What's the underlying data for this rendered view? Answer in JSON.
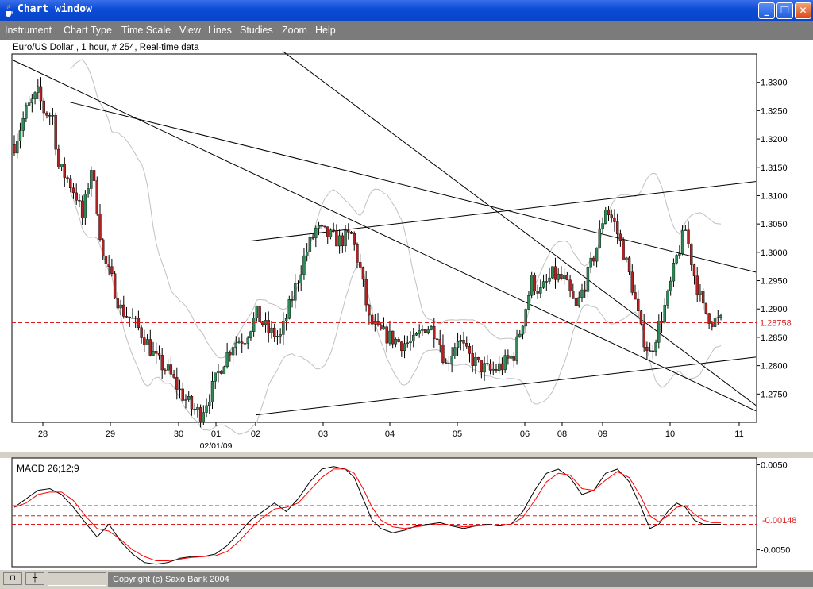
{
  "window": {
    "title": "Chart window"
  },
  "menu": [
    "Instrument",
    "Chart Type",
    "Time Scale",
    "View",
    "Lines",
    "Studies",
    "Zoom",
    "Help"
  ],
  "chart_data": [
    {
      "type": "candlestick",
      "title": "Euro/US Dollar , 1 hour, # 254, Real-time data",
      "ylim": [
        1.27,
        1.335
      ],
      "y_ticks": [
        "1.3300",
        "1.3250",
        "1.3200",
        "1.3150",
        "1.3100",
        "1.3050",
        "1.3000",
        "1.2950",
        "1.2900",
        "1.2850",
        "1.2800",
        "1.2750"
      ],
      "x_ticks": [
        "28",
        "29",
        "30",
        "01",
        "02",
        "03",
        "04",
        "05",
        "06",
        "08",
        "09",
        "10",
        "11"
      ],
      "x_subtick": "02/01/09",
      "current_price": "1.28758",
      "current_price_value": 1.28758,
      "price_path": [
        [
          0,
          1.319
        ],
        [
          4,
          1.325
        ],
        [
          8,
          1.328
        ],
        [
          10,
          1.325
        ],
        [
          13,
          1.324
        ],
        [
          15,
          1.315
        ],
        [
          18,
          1.313
        ],
        [
          21,
          1.31
        ],
        [
          23,
          1.306
        ],
        [
          26,
          1.315
        ],
        [
          28,
          1.308
        ],
        [
          30,
          1.299
        ],
        [
          33,
          1.295
        ],
        [
          36,
          1.29
        ],
        [
          40,
          1.288
        ],
        [
          44,
          1.285
        ],
        [
          48,
          1.281
        ],
        [
          52,
          1.279
        ],
        [
          56,
          1.2755
        ],
        [
          60,
          1.2725
        ],
        [
          63,
          1.2715
        ],
        [
          67,
          1.276
        ],
        [
          70,
          1.28
        ],
        [
          74,
          1.284
        ],
        [
          78,
          1.285
        ],
        [
          82,
          1.289
        ],
        [
          86,
          1.286
        ],
        [
          90,
          1.285
        ],
        [
          94,
          1.292
        ],
        [
          98,
          1.299
        ],
        [
          102,
          1.304
        ],
        [
          106,
          1.303
        ],
        [
          110,
          1.302
        ],
        [
          114,
          1.303
        ],
        [
          117,
          1.297
        ],
        [
          120,
          1.288
        ],
        [
          123,
          1.286
        ],
        [
          127,
          1.285
        ],
        [
          131,
          1.284
        ],
        [
          135,
          1.284
        ],
        [
          139,
          1.287
        ],
        [
          143,
          1.286
        ],
        [
          146,
          1.28
        ],
        [
          150,
          1.285
        ],
        [
          153,
          1.282
        ],
        [
          157,
          1.28
        ],
        [
          161,
          1.279
        ],
        [
          165,
          1.28
        ],
        [
          169,
          1.282
        ],
        [
          172,
          1.288
        ],
        [
          175,
          1.295
        ],
        [
          178,
          1.293
        ],
        [
          182,
          1.296
        ],
        [
          186,
          1.295
        ],
        [
          190,
          1.29
        ],
        [
          194,
          1.296
        ],
        [
          197,
          1.301
        ],
        [
          200,
          1.308
        ],
        [
          203,
          1.305
        ],
        [
          206,
          1.3
        ],
        [
          209,
          1.294
        ],
        [
          212,
          1.286
        ],
        [
          215,
          1.282
        ],
        [
          218,
          1.287
        ],
        [
          221,
          1.292
        ],
        [
          224,
          1.299
        ],
        [
          227,
          1.304
        ],
        [
          230,
          1.296
        ],
        [
          233,
          1.29
        ],
        [
          236,
          1.288
        ],
        [
          239,
          1.2878
        ]
      ],
      "trendlines": [
        {
          "from": [
            15,
            1.334
          ],
          "to": [
            952,
            1.272
          ]
        },
        {
          "from": [
            88,
            1.3265
          ],
          "to": [
            952,
            1.2965
          ]
        },
        {
          "from": [
            356,
            1.3355
          ],
          "to": [
            952,
            1.273
          ]
        },
        {
          "from": [
            315,
            1.302
          ],
          "to": [
            952,
            1.3125
          ]
        },
        {
          "from": [
            322,
            1.2713
          ],
          "to": [
            952,
            1.2815
          ]
        }
      ]
    },
    {
      "type": "line",
      "title": "MACD 26;12;9",
      "ylim": [
        -0.007,
        0.0058
      ],
      "y_ticks": [
        "0.0050",
        "-0.0050"
      ],
      "y_tick_values": [
        0.005,
        -0.005
      ],
      "current_value": "-0.00148",
      "current_value_num": -0.00148,
      "ref_levels": [
        0.0002,
        -0.001,
        -0.002
      ],
      "series": [
        {
          "color": "#000000",
          "values": [
            [
              0,
              0.0
            ],
            [
              4,
              0.001
            ],
            [
              8,
              0.002
            ],
            [
              12,
              0.0022
            ],
            [
              16,
              0.0015
            ],
            [
              20,
              0.0
            ],
            [
              24,
              -0.0018
            ],
            [
              28,
              -0.0035
            ],
            [
              32,
              -0.002
            ],
            [
              36,
              -0.004
            ],
            [
              40,
              -0.0055
            ],
            [
              44,
              -0.0065
            ],
            [
              48,
              -0.0067
            ],
            [
              52,
              -0.0065
            ],
            [
              56,
              -0.006
            ],
            [
              60,
              -0.0058
            ],
            [
              64,
              -0.0058
            ],
            [
              68,
              -0.0055
            ],
            [
              72,
              -0.0045
            ],
            [
              76,
              -0.003
            ],
            [
              80,
              -0.0015
            ],
            [
              84,
              -0.0005
            ],
            [
              88,
              0.0005
            ],
            [
              92,
              -0.0005
            ],
            [
              96,
              0.001
            ],
            [
              100,
              0.003
            ],
            [
              104,
              0.0045
            ],
            [
              108,
              0.0048
            ],
            [
              112,
              0.0045
            ],
            [
              115,
              0.0035
            ],
            [
              118,
              0.001
            ],
            [
              121,
              -0.0015
            ],
            [
              124,
              -0.0025
            ],
            [
              128,
              -0.003
            ],
            [
              132,
              -0.0027
            ],
            [
              136,
              -0.0022
            ],
            [
              140,
              -0.002
            ],
            [
              144,
              -0.0018
            ],
            [
              148,
              -0.0022
            ],
            [
              152,
              -0.0025
            ],
            [
              156,
              -0.0022
            ],
            [
              160,
              -0.002
            ],
            [
              164,
              -0.0022
            ],
            [
              168,
              -0.002
            ],
            [
              172,
              -0.0005
            ],
            [
              176,
              0.002
            ],
            [
              180,
              0.004
            ],
            [
              184,
              0.0045
            ],
            [
              188,
              0.0035
            ],
            [
              192,
              0.0015
            ],
            [
              196,
              0.002
            ],
            [
              200,
              0.004
            ],
            [
              204,
              0.0045
            ],
            [
              208,
              0.003
            ],
            [
              212,
              0.0
            ],
            [
              215,
              -0.0025
            ],
            [
              218,
              -0.002
            ],
            [
              221,
              -0.0005
            ],
            [
              224,
              0.0005
            ],
            [
              227,
              0.0
            ],
            [
              230,
              -0.0015
            ],
            [
              233,
              -0.002
            ],
            [
              236,
              -0.002
            ]
          ]
        },
        {
          "color": "#ff0000",
          "values": [
            [
              0,
              0.0
            ],
            [
              4,
              0.0005
            ],
            [
              8,
              0.0015
            ],
            [
              12,
              0.0018
            ],
            [
              16,
              0.0018
            ],
            [
              20,
              0.0008
            ],
            [
              24,
              -0.001
            ],
            [
              28,
              -0.0025
            ],
            [
              32,
              -0.0028
            ],
            [
              36,
              -0.0038
            ],
            [
              40,
              -0.005
            ],
            [
              44,
              -0.0058
            ],
            [
              48,
              -0.0063
            ],
            [
              52,
              -0.0063
            ],
            [
              56,
              -0.0061
            ],
            [
              60,
              -0.0059
            ],
            [
              64,
              -0.0058
            ],
            [
              68,
              -0.0057
            ],
            [
              72,
              -0.0052
            ],
            [
              76,
              -0.004
            ],
            [
              80,
              -0.0025
            ],
            [
              84,
              -0.0012
            ],
            [
              88,
              -0.0002
            ],
            [
              92,
              0.0
            ],
            [
              96,
              0.0005
            ],
            [
              100,
              0.002
            ],
            [
              104,
              0.0035
            ],
            [
              108,
              0.0045
            ],
            [
              112,
              0.0045
            ],
            [
              115,
              0.004
            ],
            [
              118,
              0.0022
            ],
            [
              121,
              0.0
            ],
            [
              124,
              -0.0015
            ],
            [
              128,
              -0.0023
            ],
            [
              132,
              -0.0025
            ],
            [
              136,
              -0.0023
            ],
            [
              140,
              -0.0021
            ],
            [
              144,
              -0.002
            ],
            [
              148,
              -0.0021
            ],
            [
              152,
              -0.0023
            ],
            [
              156,
              -0.0022
            ],
            [
              160,
              -0.0021
            ],
            [
              164,
              -0.0021
            ],
            [
              168,
              -0.002
            ],
            [
              172,
              -0.0012
            ],
            [
              176,
              0.0008
            ],
            [
              180,
              0.003
            ],
            [
              184,
              0.004
            ],
            [
              188,
              0.0038
            ],
            [
              192,
              0.0022
            ],
            [
              196,
              0.002
            ],
            [
              200,
              0.0032
            ],
            [
              204,
              0.0042
            ],
            [
              208,
              0.0035
            ],
            [
              212,
              0.0012
            ],
            [
              215,
              -0.001
            ],
            [
              218,
              -0.0017
            ],
            [
              221,
              -0.001
            ],
            [
              224,
              0.0
            ],
            [
              227,
              0.0002
            ],
            [
              230,
              -0.0008
            ],
            [
              233,
              -0.0015
            ],
            [
              236,
              -0.0018
            ]
          ]
        }
      ]
    }
  ],
  "status": {
    "copyright": "Copyright (c) Saxo Bank 2004"
  },
  "colors": {
    "up": "#2e8b57",
    "down": "#b22222",
    "band": "#c0c0c0",
    "ref": "#d81e1e",
    "titlebar": "#0a4bd6",
    "menubar": "#7b7b7b"
  }
}
